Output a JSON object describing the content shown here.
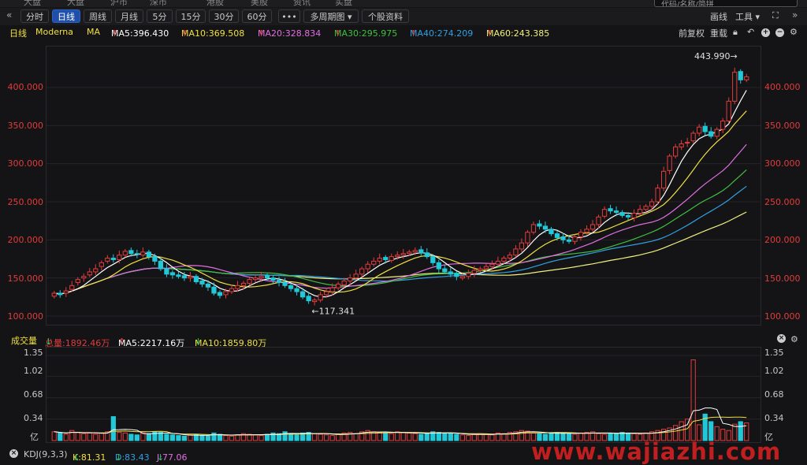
{
  "topbar": {
    "menu": [
      "大盘",
      "大盘",
      "沪市",
      "深市",
      "港股",
      "美股",
      "资讯",
      "实盘"
    ],
    "search_placeholder": "代码/名称/简拼"
  },
  "toolbar": {
    "back_icon": "double-chevron-left-icon",
    "periods": [
      "分时",
      "日线",
      "周线",
      "月线",
      "5分",
      "15分",
      "30分",
      "60分"
    ],
    "active_period": "日线",
    "more": "•••",
    "multi": "多周期图",
    "stock_info": "个股资料",
    "draw": "画线",
    "tools": "工具",
    "expand_icon": "expand-icon",
    "forward_icon": "double-chevron-right-icon"
  },
  "ma_bar": {
    "period": "日线",
    "stock": "Moderna",
    "ma": "MA",
    "ma5": "MA5:396.430",
    "ma10": "MA10:369.508",
    "ma20": "MA20:328.834",
    "ma30": "MA30:295.975",
    "ma40": "MA40:274.209",
    "ma60": "MA60:243.385",
    "adjust": "前复权",
    "reset": "重载",
    "colors": {
      "ma5": "#ffffff",
      "ma10": "#f0e040",
      "ma20": "#e070e0",
      "ma30": "#40c040",
      "ma40": "#30a0e0",
      "ma60": "#f0f080",
      "up": "#e23c3c",
      "down": "#20c8d8"
    }
  },
  "price_chart": {
    "y_ticks": [
      "400.000",
      "350.000",
      "300.000",
      "250.000",
      "200.000",
      "150.000",
      "100.000"
    ],
    "high_label": "443.990",
    "low_label": "117.341"
  },
  "vol_bar": {
    "title": "成交量",
    "total": "总量:1892.46万",
    "ma5": "MA5:2217.16万",
    "ma10": "MA10:1859.80万"
  },
  "vol_chart": {
    "y_ticks": [
      "1.35",
      "1.02",
      "0.68",
      "0.34"
    ],
    "unit": "亿"
  },
  "kdj_bar": {
    "title": "KDJ(9,3,3)",
    "k": "K:81.31",
    "d": "D:83.43",
    "j": "J:77.06"
  },
  "watermark": "www.wajiazhi.com",
  "chart_data": {
    "type": "candlestick",
    "title": "Moderna",
    "y_range": [
      100,
      450
    ],
    "closes": [
      130,
      128,
      133,
      140,
      148,
      152,
      158,
      162,
      170,
      176,
      174,
      180,
      185,
      182,
      181,
      184,
      178,
      172,
      162,
      155,
      154,
      152,
      150,
      152,
      145,
      142,
      138,
      130,
      127,
      132,
      136,
      140,
      143,
      148,
      150,
      152,
      150,
      147,
      144,
      140,
      136,
      132,
      125,
      120,
      121,
      128,
      132,
      137,
      142,
      146,
      150,
      155,
      162,
      168,
      172,
      176,
      174,
      178,
      180,
      182,
      184,
      186,
      183,
      178,
      170,
      162,
      158,
      155,
      152,
      152,
      156,
      160,
      162,
      165,
      168,
      172,
      176,
      180,
      188,
      196,
      210,
      220,
      218,
      214,
      208,
      203,
      200,
      198,
      204,
      210,
      214,
      220,
      230,
      240,
      238,
      236,
      232,
      230,
      235,
      240,
      244,
      250,
      268,
      290,
      310,
      322,
      326,
      328,
      340,
      348,
      342,
      336,
      345,
      356,
      382,
      420,
      410,
      414
    ],
    "opens": [
      126,
      130,
      130,
      135,
      144,
      150,
      154,
      158,
      165,
      172,
      176,
      174,
      180,
      186,
      182,
      180,
      184,
      178,
      172,
      162,
      157,
      154,
      153,
      150,
      152,
      146,
      142,
      138,
      131,
      128,
      132,
      136,
      140,
      143,
      148,
      150,
      153,
      150,
      147,
      144,
      140,
      136,
      132,
      126,
      119,
      121,
      128,
      132,
      137,
      141,
      146,
      150,
      155,
      162,
      168,
      172,
      177,
      173,
      178,
      180,
      182,
      184,
      187,
      183,
      178,
      170,
      162,
      158,
      156,
      150,
      152,
      156,
      160,
      162,
      165,
      168,
      172,
      176,
      180,
      188,
      196,
      210,
      221,
      218,
      214,
      208,
      204,
      200,
      198,
      204,
      210,
      214,
      220,
      231,
      241,
      238,
      236,
      232,
      229,
      235,
      240,
      244,
      250,
      268,
      291,
      310,
      322,
      327,
      330,
      340,
      349,
      342,
      336,
      345,
      356,
      382,
      421,
      410
    ],
    "volumes": [
      0.14,
      0.12,
      0.1,
      0.16,
      0.13,
      0.11,
      0.12,
      0.1,
      0.12,
      0.14,
      0.38,
      0.13,
      0.12,
      0.1,
      0.09,
      0.12,
      0.11,
      0.14,
      0.13,
      0.1,
      0.09,
      0.08,
      0.07,
      0.09,
      0.1,
      0.08,
      0.07,
      0.12,
      0.1,
      0.08,
      0.07,
      0.09,
      0.11,
      0.1,
      0.09,
      0.08,
      0.1,
      0.12,
      0.11,
      0.14,
      0.1,
      0.09,
      0.12,
      0.13,
      0.11,
      0.1,
      0.09,
      0.08,
      0.1,
      0.12,
      0.13,
      0.11,
      0.14,
      0.16,
      0.14,
      0.13,
      0.12,
      0.11,
      0.14,
      0.13,
      0.12,
      0.11,
      0.1,
      0.12,
      0.14,
      0.13,
      0.12,
      0.11,
      0.1,
      0.09,
      0.08,
      0.1,
      0.11,
      0.1,
      0.09,
      0.12,
      0.11,
      0.13,
      0.14,
      0.16,
      0.15,
      0.12,
      0.11,
      0.1,
      0.12,
      0.13,
      0.12,
      0.11,
      0.1,
      0.12,
      0.13,
      0.14,
      0.11,
      0.1,
      0.12,
      0.11,
      0.13,
      0.12,
      0.11,
      0.1,
      0.12,
      0.14,
      0.16,
      0.18,
      0.2,
      0.24,
      0.3,
      0.34,
      1.28,
      0.25,
      0.42,
      0.3,
      0.22,
      0.18,
      0.16,
      0.26,
      0.3,
      0.28
    ]
  }
}
